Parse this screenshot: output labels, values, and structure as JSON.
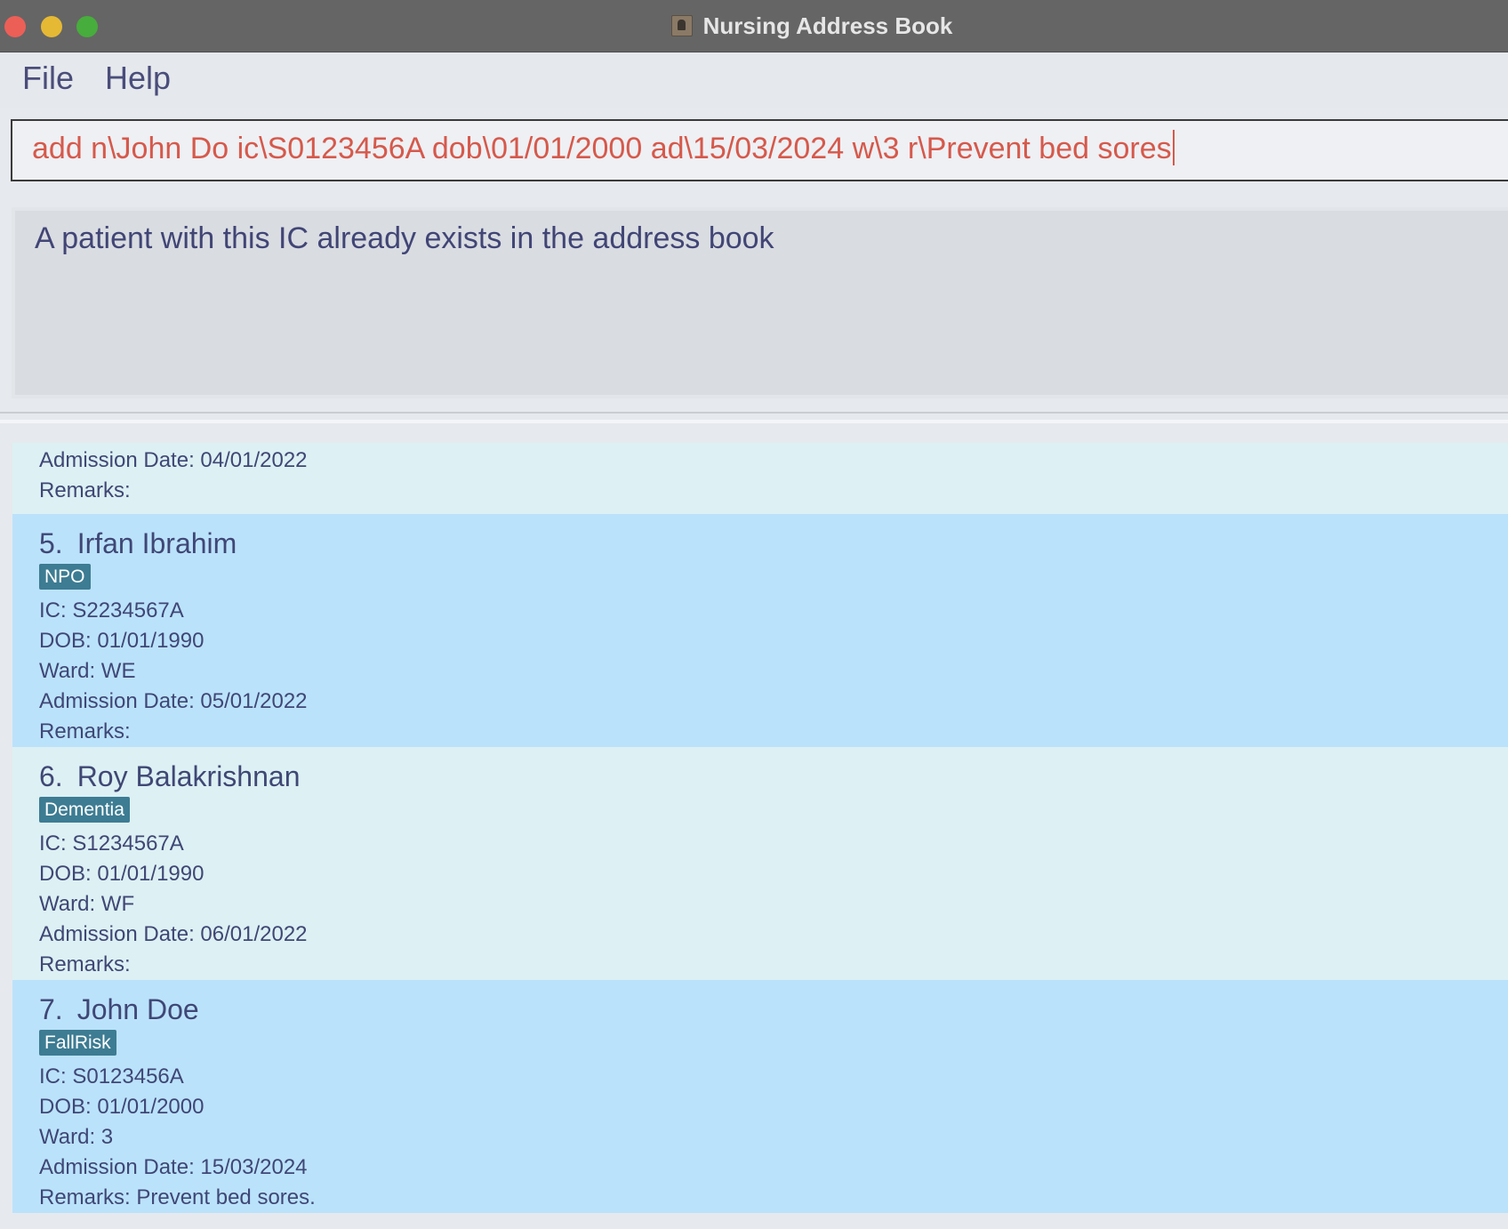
{
  "window": {
    "title": "Nursing Address Book"
  },
  "menu": {
    "items": [
      "File",
      "Help"
    ]
  },
  "command": {
    "value": "add n\\John Do ic\\S0123456A dob\\01/01/2000 ad\\15/03/2024 w\\3 r\\Prevent bed sores"
  },
  "result": {
    "message": "A patient with this IC already exists in the address book"
  },
  "patients": {
    "partial": {
      "admission": "Admission Date: 04/01/2022",
      "remarks": "Remarks:"
    },
    "list": [
      {
        "index": "5.",
        "name": "Irfan Ibrahim",
        "tag": "NPO",
        "ic": "IC: S2234567A",
        "dob": "DOB: 01/01/1990",
        "ward": "Ward: WE",
        "admission": "Admission Date: 05/01/2022",
        "remarks": "Remarks:"
      },
      {
        "index": "6.",
        "name": "Roy Balakrishnan",
        "tag": "Dementia",
        "ic": "IC: S1234567A",
        "dob": "DOB: 01/01/1990",
        "ward": "Ward: WF",
        "admission": "Admission Date: 06/01/2022",
        "remarks": "Remarks:"
      },
      {
        "index": "7.",
        "name": "John Doe",
        "tag": "FallRisk",
        "ic": "IC: S0123456A",
        "dob": "DOB: 01/01/2000",
        "ward": "Ward: 3",
        "admission": "Admission Date: 15/03/2024",
        "remarks": "Remarks: Prevent bed sores."
      }
    ]
  },
  "colors": {
    "titlebar": "#656565",
    "command_text": "#d6594b",
    "text": "#3f4775",
    "card_light": "#ddf0f3",
    "card_blue": "#bbe2fb",
    "tag": "#3d7c93"
  }
}
